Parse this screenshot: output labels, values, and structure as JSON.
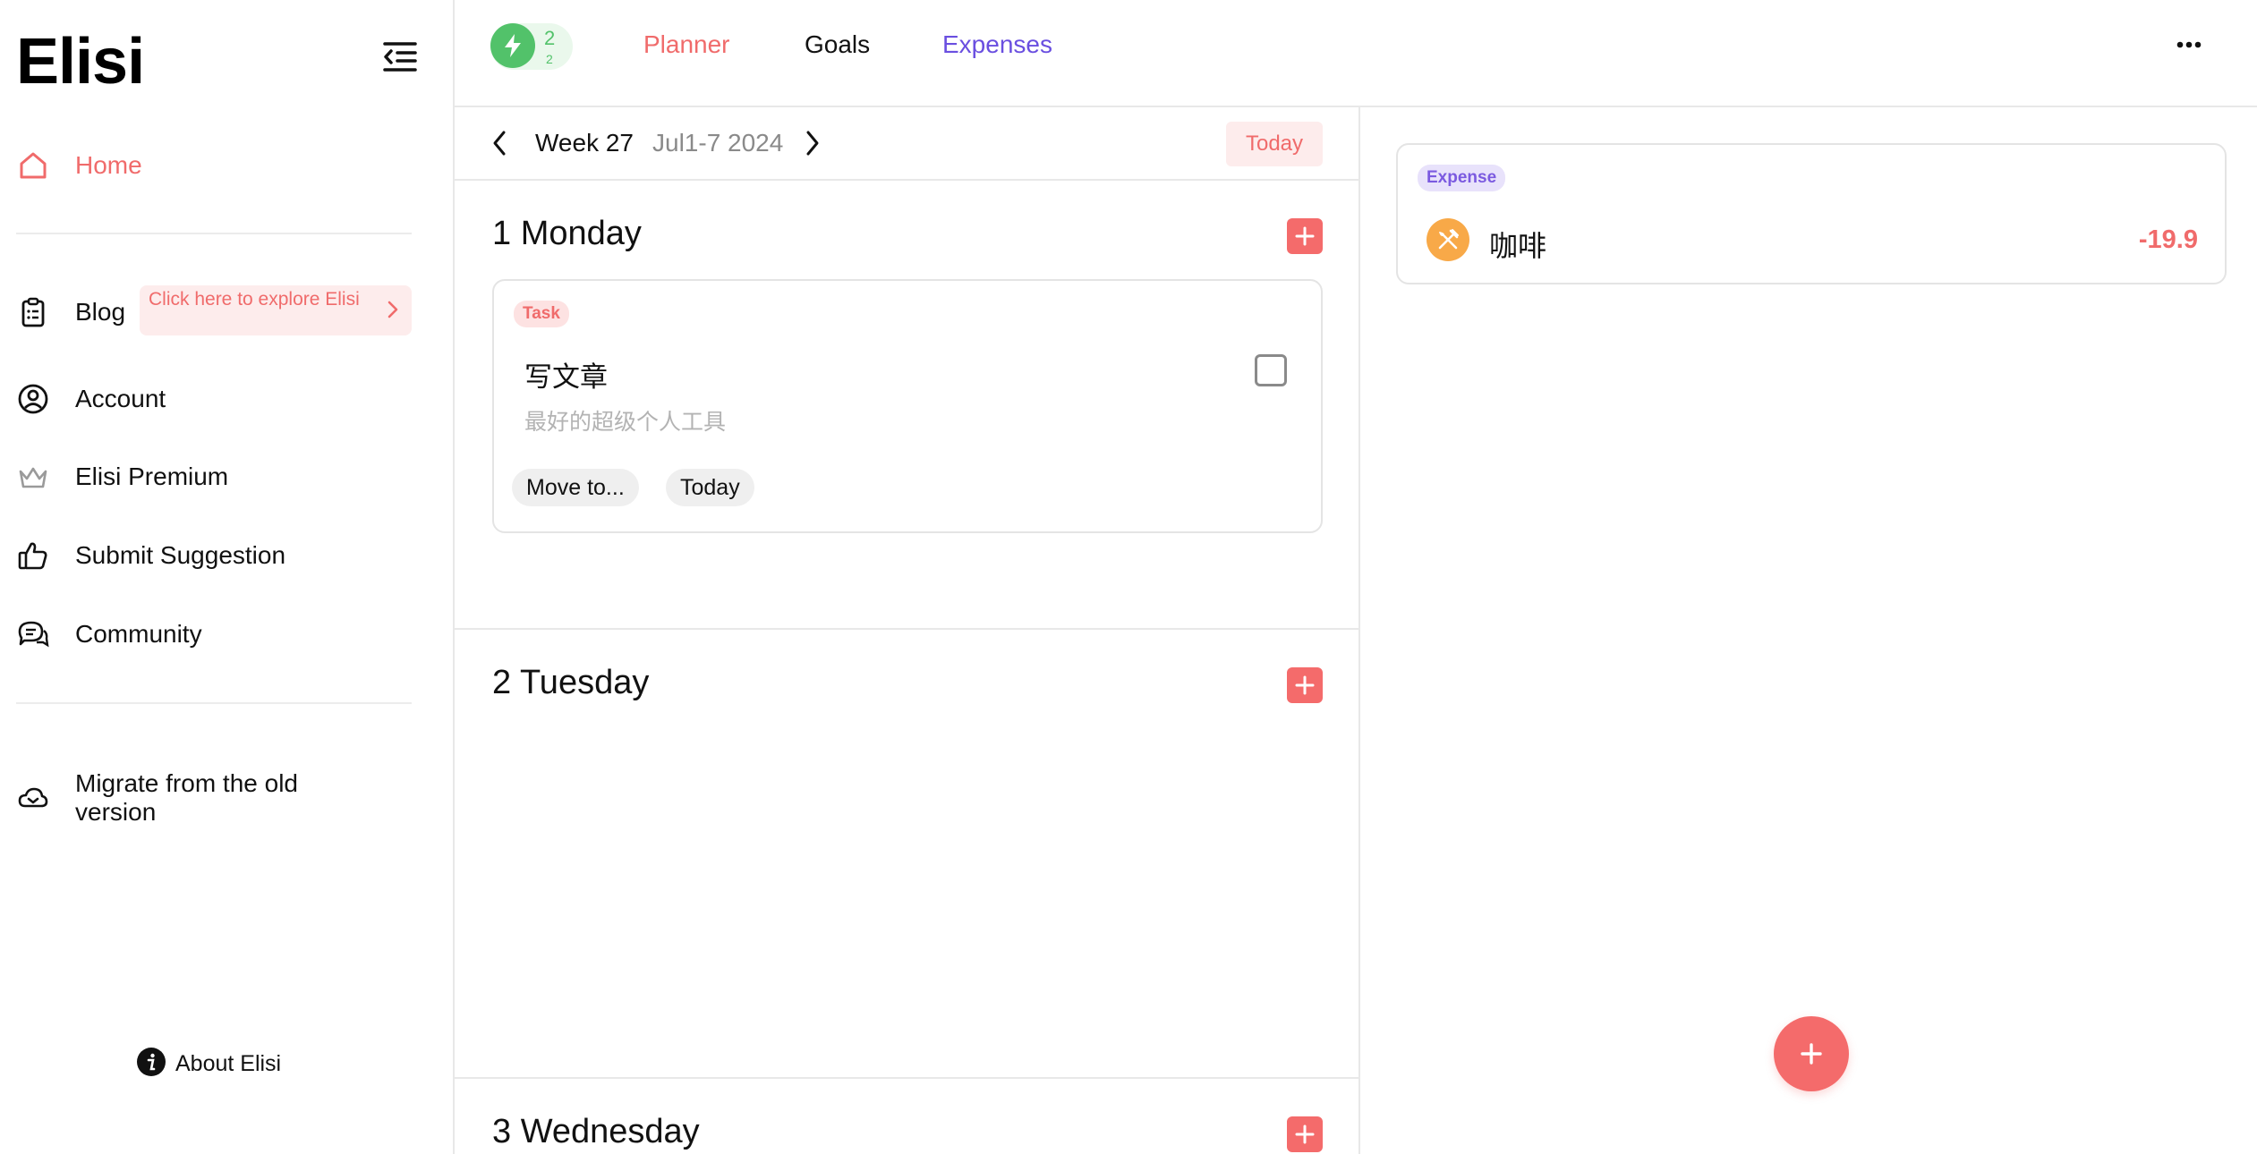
{
  "sidebar": {
    "brand": "Elisi",
    "home": "Home",
    "blog": "Blog",
    "blog_promo": "Click here to explore Elisi",
    "account": "Account",
    "premium": "Elisi Premium",
    "suggestion": "Submit Suggestion",
    "community": "Community",
    "migrate": "Migrate from the old version",
    "about": "About Elisi"
  },
  "topbar": {
    "energy_value": "2",
    "energy_sub": "2",
    "tabs": [
      {
        "label": "Planner",
        "color": "#f06b6b"
      },
      {
        "label": "Goals",
        "color": "#111111"
      },
      {
        "label": "Expenses",
        "color": "#6a4fe0"
      }
    ]
  },
  "planner": {
    "week_label": "Week 27",
    "date_range": "Jul1-7 2024",
    "today_button": "Today",
    "days": [
      {
        "title": "1 Monday"
      },
      {
        "title": "2 Tuesday"
      },
      {
        "title": "3 Wednesday"
      }
    ],
    "task": {
      "tag": "Task",
      "title": "写文章",
      "description": "最好的超级个人工具",
      "move_button": "Move to...",
      "today_button": "Today",
      "done": false
    }
  },
  "expenses": {
    "item": {
      "tag": "Expense",
      "name": "咖啡",
      "amount": "-19.9",
      "icon": "fork-knife-icon"
    }
  },
  "colors": {
    "accent": "#f46b6b",
    "expense_purple": "#7b5ae0",
    "energy_green": "#52c26a",
    "expense_icon_orange": "#f8a948"
  }
}
